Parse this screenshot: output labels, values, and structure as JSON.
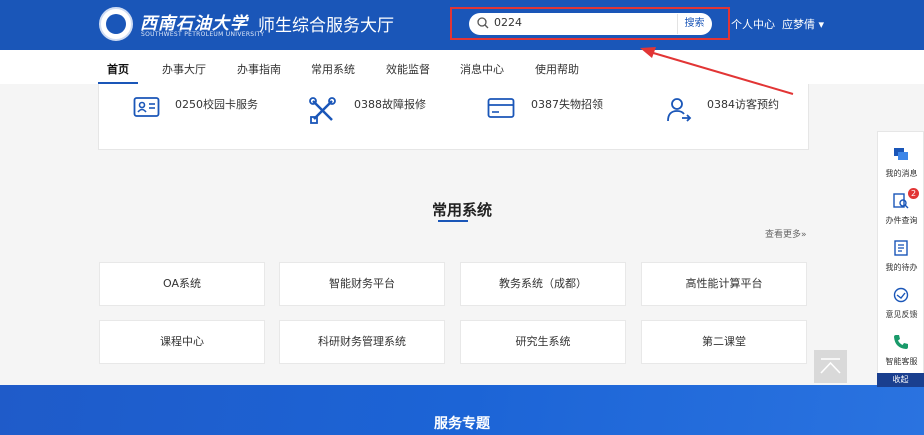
{
  "header": {
    "school_name_cn": "西南石油大学",
    "school_name_en": "SOUTHWEST PETROLEUM UNIVERSITY",
    "site_title": "师生综合服务大厅",
    "search_value": "0224",
    "search_button": "搜索",
    "personal_center": "个人中心",
    "user_name": "应梦倩"
  },
  "nav": {
    "items": [
      "首页",
      "办事大厅",
      "办事指南",
      "常用系统",
      "效能监督",
      "消息中心",
      "使用帮助"
    ]
  },
  "services": [
    {
      "label": "0250校园卡服务",
      "icon": "id-card-icon"
    },
    {
      "label": "0388故障报修",
      "icon": "tools-icon"
    },
    {
      "label": "0387失物招领",
      "icon": "credit-card-icon"
    },
    {
      "label": "0384访客预约",
      "icon": "visitor-icon"
    }
  ],
  "common_systems": {
    "title": "常用系统",
    "more": "查看更多»",
    "items": [
      "OA系统",
      "智能财务平台",
      "教务系统（成都）",
      "高性能计算平台",
      "课程中心",
      "科研财务管理系统",
      "研究生系统",
      "第二课堂"
    ]
  },
  "service_topics": {
    "title": "服务专题"
  },
  "side_panel": {
    "items": [
      "我的消息",
      "办件查询",
      "我的待办",
      "意见反馈",
      "智能客服"
    ],
    "badge": "2",
    "collapse": "收起"
  },
  "colors": {
    "primary": "#1a56b8",
    "highlight": "#e23535",
    "band": "#1c64d6"
  }
}
